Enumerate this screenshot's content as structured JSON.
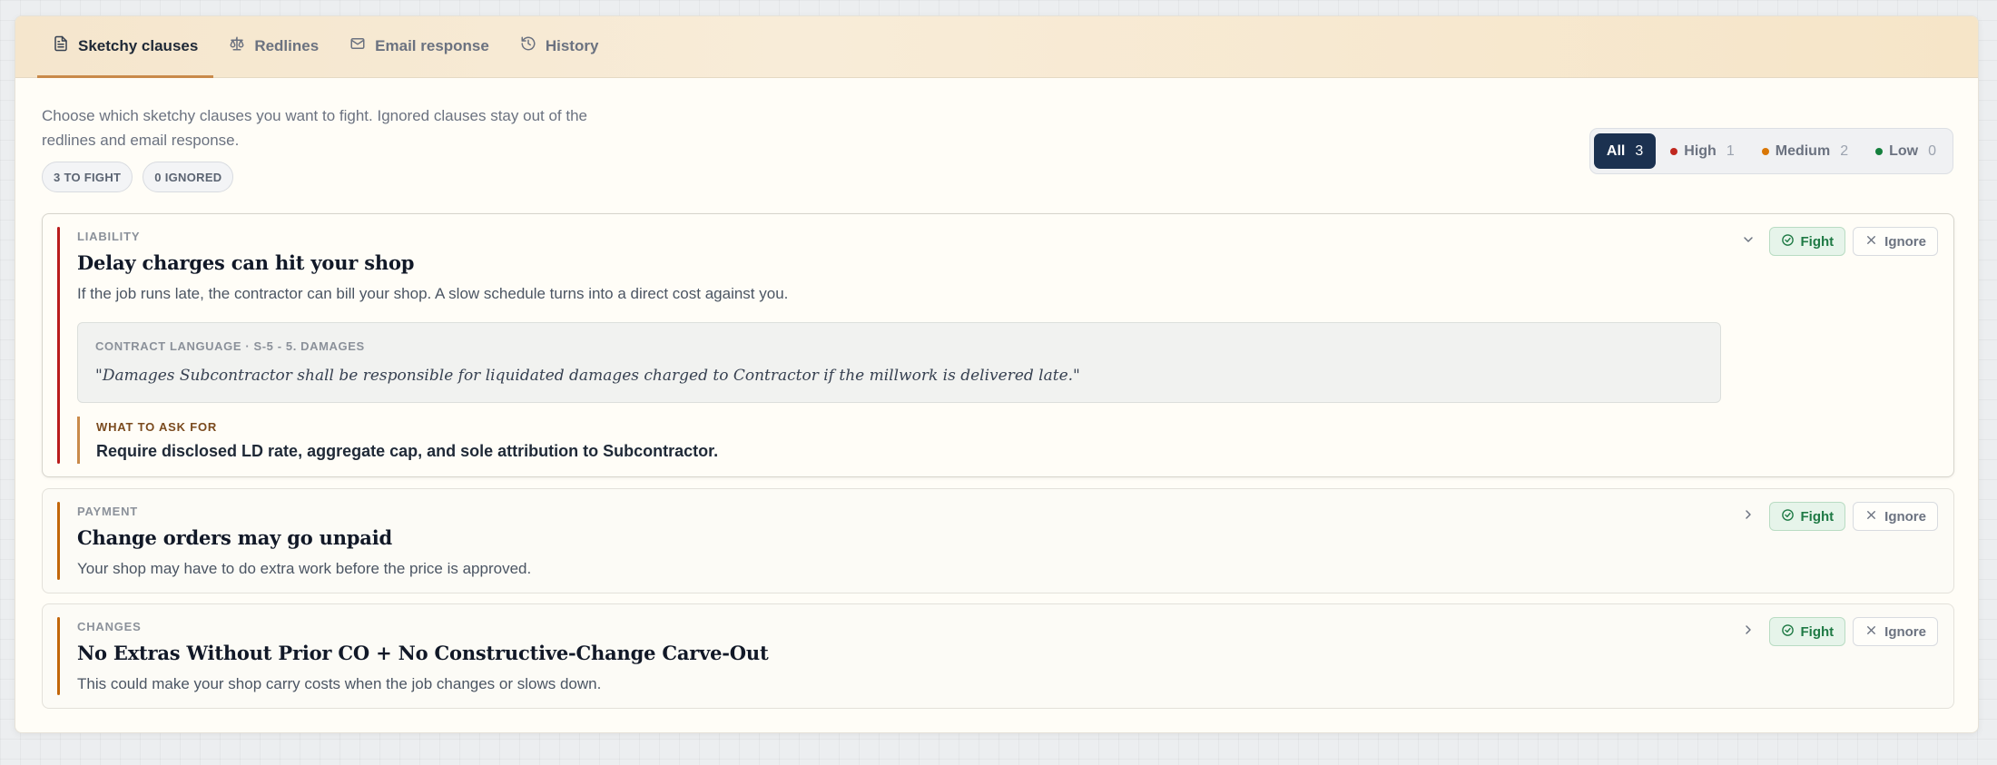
{
  "tabs": [
    {
      "label": "Sketchy clauses",
      "icon": "document-icon",
      "active": true
    },
    {
      "label": "Redlines",
      "icon": "scale-icon",
      "active": false
    },
    {
      "label": "Email response",
      "icon": "envelope-icon",
      "active": false
    },
    {
      "label": "History",
      "icon": "history-icon",
      "active": false
    }
  ],
  "intro": "Choose which sketchy clauses you want to fight. Ignored clauses stay out of the redlines and email response.",
  "summary": {
    "fight": "3 TO FIGHT",
    "ignored": "0 IGNORED"
  },
  "filters": [
    {
      "label": "All",
      "count": "3",
      "active": true
    },
    {
      "label": "High",
      "count": "1",
      "color": "#c0281f"
    },
    {
      "label": "Medium",
      "count": "2",
      "color": "#d97706"
    },
    {
      "label": "Low",
      "count": "0",
      "color": "#15803d"
    }
  ],
  "actions": {
    "fight": "Fight",
    "ignore": "Ignore"
  },
  "clauses": [
    {
      "category": "LIABILITY",
      "title": "Delay charges can hit your shop",
      "description": "If the job runs late, the contractor can bill your shop. A slow schedule turns into a direct cost against you.",
      "severity_color": "#b91c1c",
      "expanded": true,
      "contract_label": "CONTRACT LANGUAGE · S-5 - 5. DAMAGES",
      "contract_quote": "\"Damages Subcontractor shall be responsible for liquidated damages charged to Contractor if the millwork is delivered late.\"",
      "ask_label": "WHAT TO ASK FOR",
      "ask_text": "Require disclosed LD rate, aggregate cap, and sole attribution to Subcontractor."
    },
    {
      "category": "PAYMENT",
      "title": "Change orders may go unpaid",
      "description": "Your shop may have to do extra work before the price is approved.",
      "severity_color": "#c2660a",
      "expanded": false
    },
    {
      "category": "CHANGES",
      "title": "No Extras Without Prior CO + No Constructive-Change Carve-Out",
      "description": "This could make your shop carry costs when the job changes or slows down.",
      "severity_color": "#c2660a",
      "expanded": false
    }
  ]
}
